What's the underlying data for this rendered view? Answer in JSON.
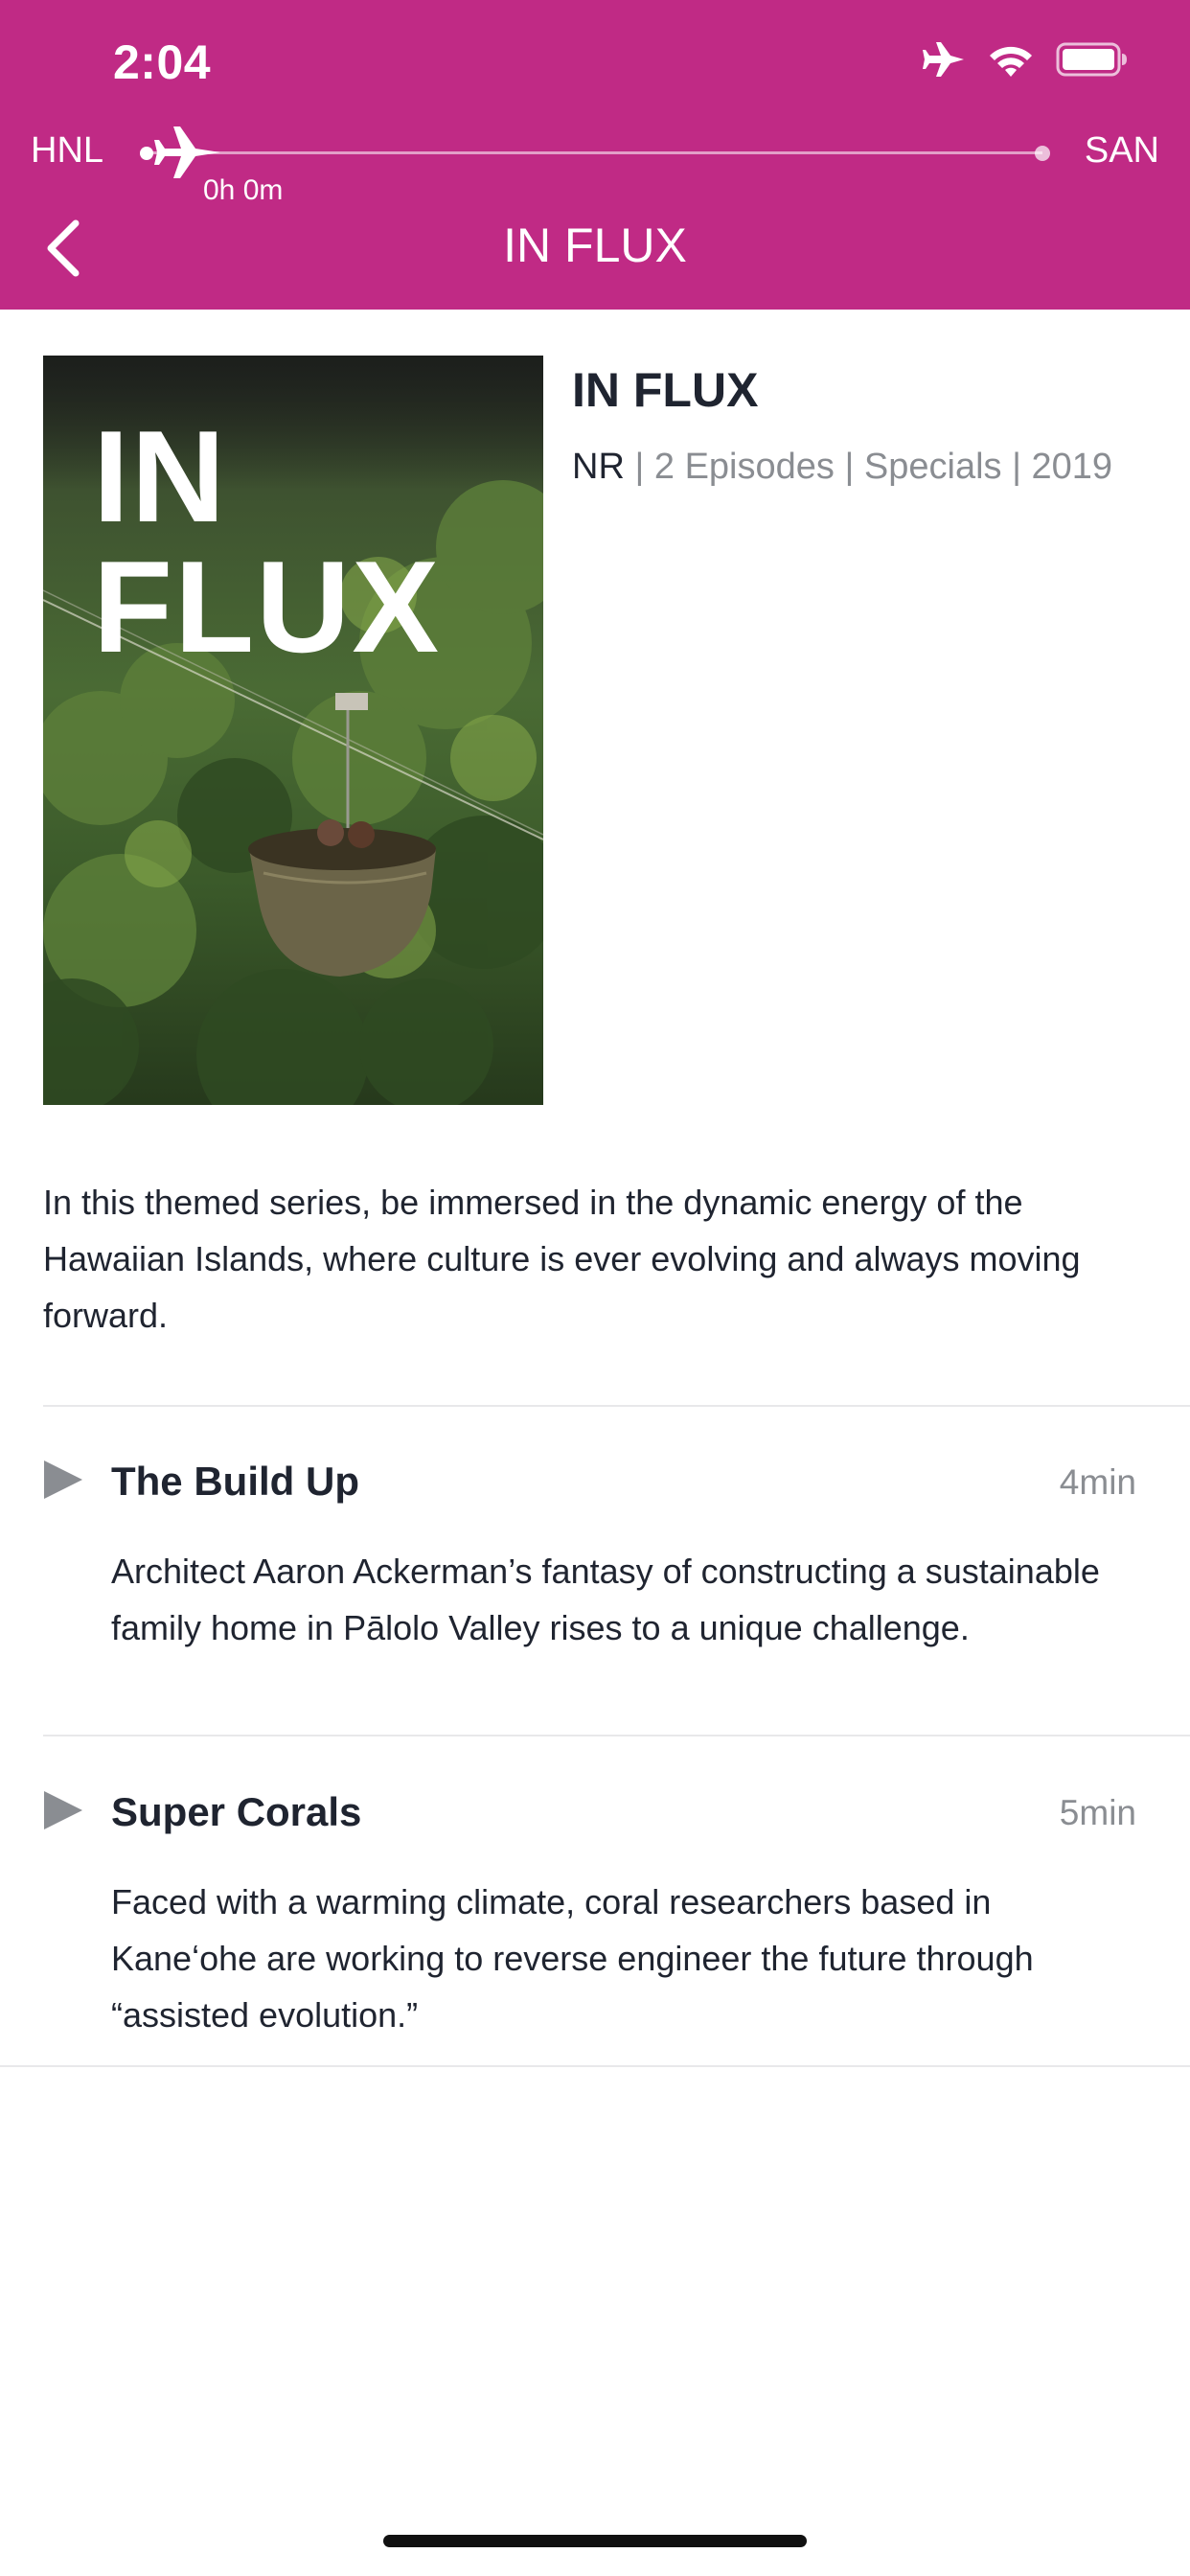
{
  "status_bar": {
    "time": "2:04",
    "icons": [
      "airplane-mode-icon",
      "wifi-icon",
      "battery-icon"
    ]
  },
  "flight": {
    "origin": "HNL",
    "destination": "SAN",
    "elapsed": "0h 0m",
    "progress": 0.0
  },
  "nav": {
    "title": "IN FLUX",
    "back_icon": "chevron-left-icon"
  },
  "poster": {
    "title_line1": "IN",
    "title_line2": "FLUX"
  },
  "show": {
    "title": "IN FLUX",
    "rating": "NR",
    "meta": "| 2 Episodes | Specials | 2019",
    "description": "In this themed series, be immersed in the dynamic energy of the Hawaiian Islands, where culture is ever evolving and always moving forward."
  },
  "episodes": [
    {
      "title": "The Build Up",
      "duration": "4min",
      "description": "Architect Aaron Ackerman’s fantasy of constructing a sustainable family home in Pālolo Valley rises to a unique challenge."
    },
    {
      "title": "Super Corals",
      "duration": "5min",
      "description": "Faced with a warming climate, coral researchers based in Kaneʻohe are working to reverse engineer the future through “assisted evolution.”"
    }
  ],
  "colors": {
    "header": "#c02a85",
    "text": "#1f2430",
    "muted": "#8a8d92",
    "divider": "#e8e8ea"
  }
}
